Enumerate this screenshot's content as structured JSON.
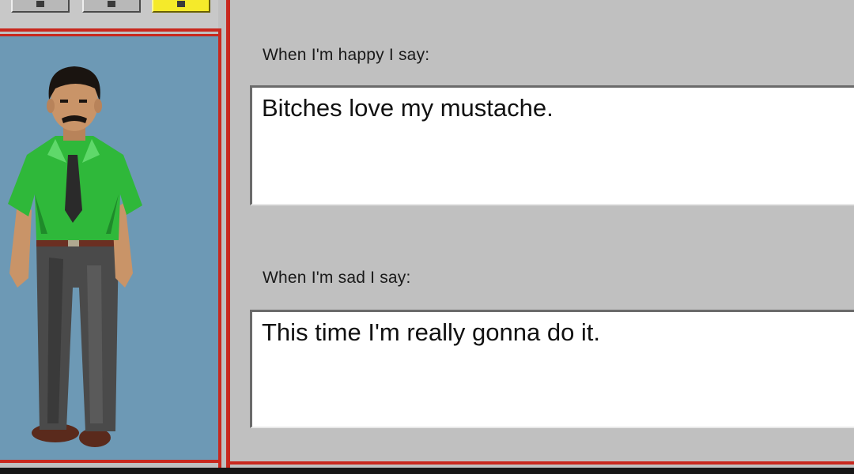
{
  "toolbar": {
    "buttons": [
      {
        "name": "toolbar-button-1",
        "active": false
      },
      {
        "name": "toolbar-button-2",
        "active": false
      },
      {
        "name": "toolbar-button-3",
        "active": true
      }
    ]
  },
  "avatar": {
    "description_icon": "character-avatar",
    "colors": {
      "background": "#6d99b5",
      "shirt": "#2fb83a",
      "pants": "#4a4a4a"
    }
  },
  "form": {
    "happy_label": "When I'm happy I say:",
    "happy_value": "Bitches love my mustache.",
    "sad_label": "When I'm sad I say:",
    "sad_value": "This time I'm really gonna do it."
  },
  "colors": {
    "frame_red": "#c8281e",
    "window_gray": "#c0c0c0",
    "active_button": "#f5ea2a"
  }
}
